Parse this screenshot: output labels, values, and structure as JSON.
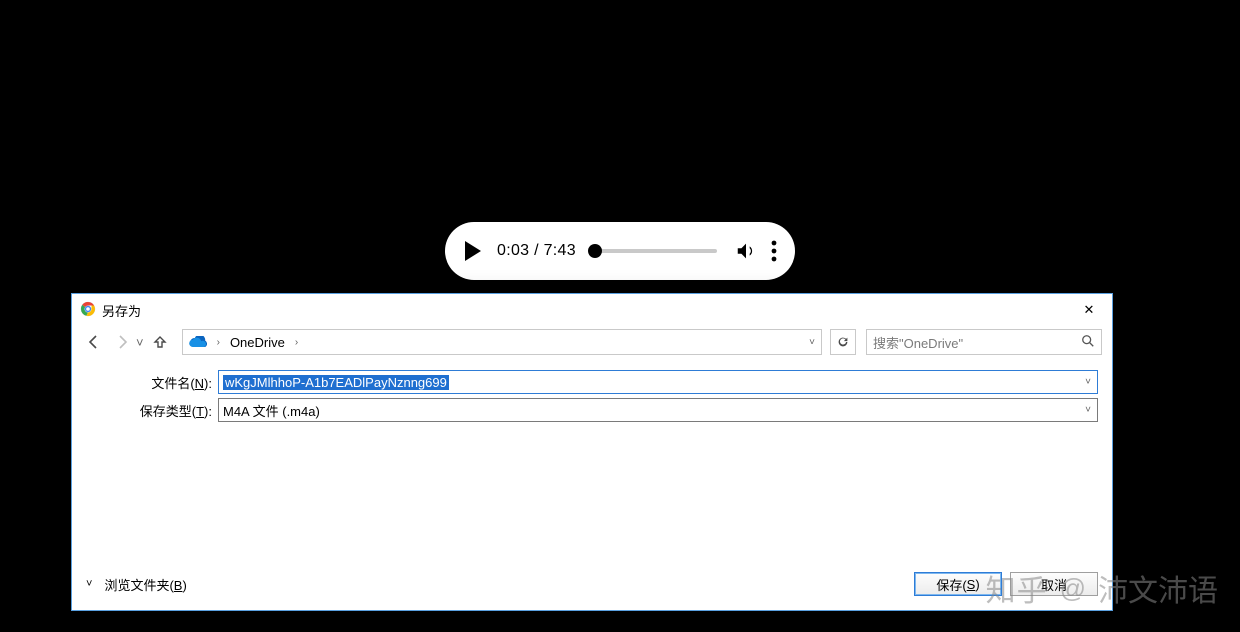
{
  "player": {
    "current_time": "0:03",
    "total_time": "7:43",
    "time_display": "0:03 / 7:43",
    "progress_pct": 0.7
  },
  "dialog": {
    "title": "另存为",
    "close_glyph": "✕",
    "nav": {
      "back": "←",
      "forward": "→",
      "recent_caret": "˅",
      "up": "↑"
    },
    "address": {
      "location": "OneDrive",
      "crumb_chev": "›",
      "dropdown_caret": "˅"
    },
    "refresh_glyph": "↻",
    "search": {
      "placeholder": "搜索\"OneDrive\"",
      "icon": "🔍"
    },
    "filename": {
      "label_prefix": "文件名(",
      "label_hotkey": "N",
      "label_suffix": "):",
      "value": "wKgJMlhhoP-A1b7EADlPayNznng699"
    },
    "filetype": {
      "label_prefix": "保存类型(",
      "label_hotkey": "T",
      "label_suffix": "):",
      "value": "M4A 文件 (.m4a)"
    },
    "browse": {
      "caret": "˅",
      "text_prefix": "浏览文件夹(",
      "text_hotkey": "B",
      "text_suffix": ")"
    },
    "buttons": {
      "save_prefix": "保存(",
      "save_hotkey": "S",
      "save_suffix": ")",
      "cancel": "取消"
    }
  },
  "watermark": {
    "logo": "知乎",
    "at": "@",
    "user": "沛文沛语"
  }
}
